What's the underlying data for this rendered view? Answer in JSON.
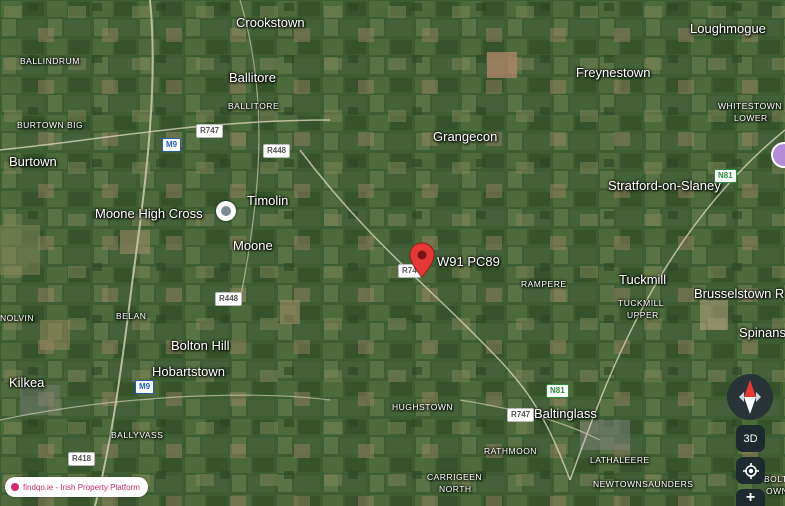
{
  "map": {
    "places": {
      "crookstown": "Crookstown",
      "loughmogue": "Loughmogue",
      "ballindrum": "BALLINDRUM",
      "ballitore": "Ballitore",
      "ballitore_local": "BALLITORE",
      "freynestown": "Freynestown",
      "whitestown_lower_1": "WHITESTOWN",
      "whitestown_lower_2": "LOWER",
      "burtown_big": "BURTOWN BIG",
      "burtown": "Burtown",
      "grangecon": "Grangecon",
      "stratford": "Stratford-on-Slaney",
      "timolin": "Timolin",
      "moone": "Moone",
      "rampere": "RAMPERE",
      "tuckmill": "Tuckmill",
      "tuckmill_upper_1": "TUCKMILL",
      "tuckmill_upper_2": "UPPER",
      "brusselstown": "Brusselstown R",
      "nolvin": "NOLVIN",
      "belan": "BELAN",
      "spinans": "Spinans",
      "bolton_hill": "Bolton Hill",
      "hobartstown": "Hobartstown",
      "kilkea": "Kilkea",
      "hughstown": "HUGHSTOWN",
      "baltinglass": "Baltinglass",
      "ballyvass": "BALLYVASS",
      "rathmoon": "RATHMOON",
      "lathaleere": "LATHALEERE",
      "carrigeen_north_1": "CARRIGEEN",
      "carrigeen_north_2": "NORTH",
      "newtownsaunders": "NEWTOWNSAUNDERS",
      "bolts_1": "BOLTS",
      "bolts_2": "OWN"
    },
    "landmark": "Moone High Cross",
    "pin_label": "W91 PC89",
    "roads": {
      "r747_top": "R747",
      "m9_top": "M9",
      "r448_top": "R448",
      "n81_right": "N81",
      "r74_pin": "R74",
      "r448_mid": "R448",
      "m9_bottom": "M9",
      "n81_bottom": "N81",
      "r747_bottom": "R747",
      "r418": "R418"
    },
    "attribution": "findqo.ie - Irish Property Platform",
    "controls": {
      "three_d": "3D",
      "zoom_in": "+"
    },
    "colors": {
      "pin": "#e53935",
      "attribution": "#d12a70",
      "compass_north": "#e53935"
    }
  }
}
